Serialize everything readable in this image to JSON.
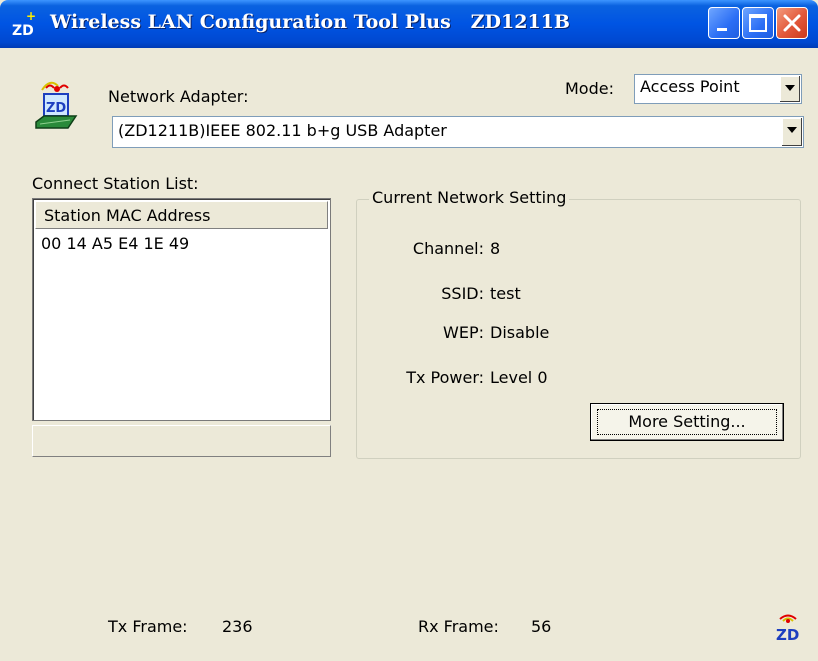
{
  "titlebar": {
    "title": "Wireless LAN Configuration Tool Plus   ZD1211B",
    "icon_text": "ZD"
  },
  "adapter": {
    "label": "Network Adapter:",
    "selected": "(ZD1211B)IEEE 802.11 b+g USB Adapter"
  },
  "mode": {
    "label": "Mode:",
    "selected": "Access Point"
  },
  "station_list": {
    "label": "Connect Station List:",
    "column_header": "Station MAC Address",
    "rows": [
      "00 14 A5 E4 1E 49"
    ]
  },
  "network_setting": {
    "title": "Current Network Setting",
    "fields": [
      {
        "label": "Channel:",
        "value": "8"
      },
      {
        "label": "SSID:",
        "value": "test"
      },
      {
        "label": "WEP:",
        "value": "Disable"
      },
      {
        "label": "Tx Power:",
        "value": "Level 0"
      }
    ],
    "more_button": "More Setting..."
  },
  "status": {
    "tx_label": "Tx Frame:",
    "tx_value": "236",
    "rx_label": "Rx Frame:",
    "rx_value": "56"
  },
  "logo_text": "ZD",
  "colors": {
    "titlebar": "#0054e3",
    "window_bg": "#ece9d8",
    "logo_blue": "#1d3fbf",
    "antenna_red": "#e00000"
  }
}
